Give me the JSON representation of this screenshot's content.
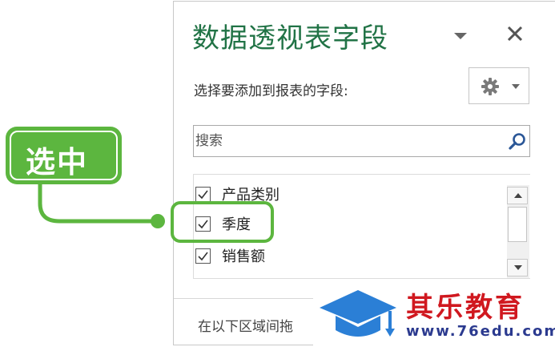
{
  "pane": {
    "title": "数据透视表字段",
    "subtitle": "选择要添加到报表的字段:",
    "search_placeholder": "搜索",
    "fields": [
      {
        "label": "产品类别",
        "checked": true
      },
      {
        "label": "季度",
        "checked": true
      },
      {
        "label": "销售额",
        "checked": true
      }
    ],
    "hint": "在以下区域间拖"
  },
  "callout": {
    "label": "选中"
  },
  "watermark": {
    "name": "其乐教育",
    "url": "www.76edu.com"
  },
  "colors": {
    "accent_green": "#5cb63f",
    "title_green": "#217346",
    "brand_red": "#d0181f",
    "brand_blue": "#2b7fd6"
  },
  "icons": {
    "menu": "chevron-down-icon",
    "close": "close-icon",
    "tools": "gear-icon",
    "search": "search-icon",
    "check": "checkmark-icon",
    "scroll_up": "scroll-up-arrow-icon",
    "scroll_down": "scroll-down-arrow-icon",
    "logo": "graduation-cap-icon"
  }
}
